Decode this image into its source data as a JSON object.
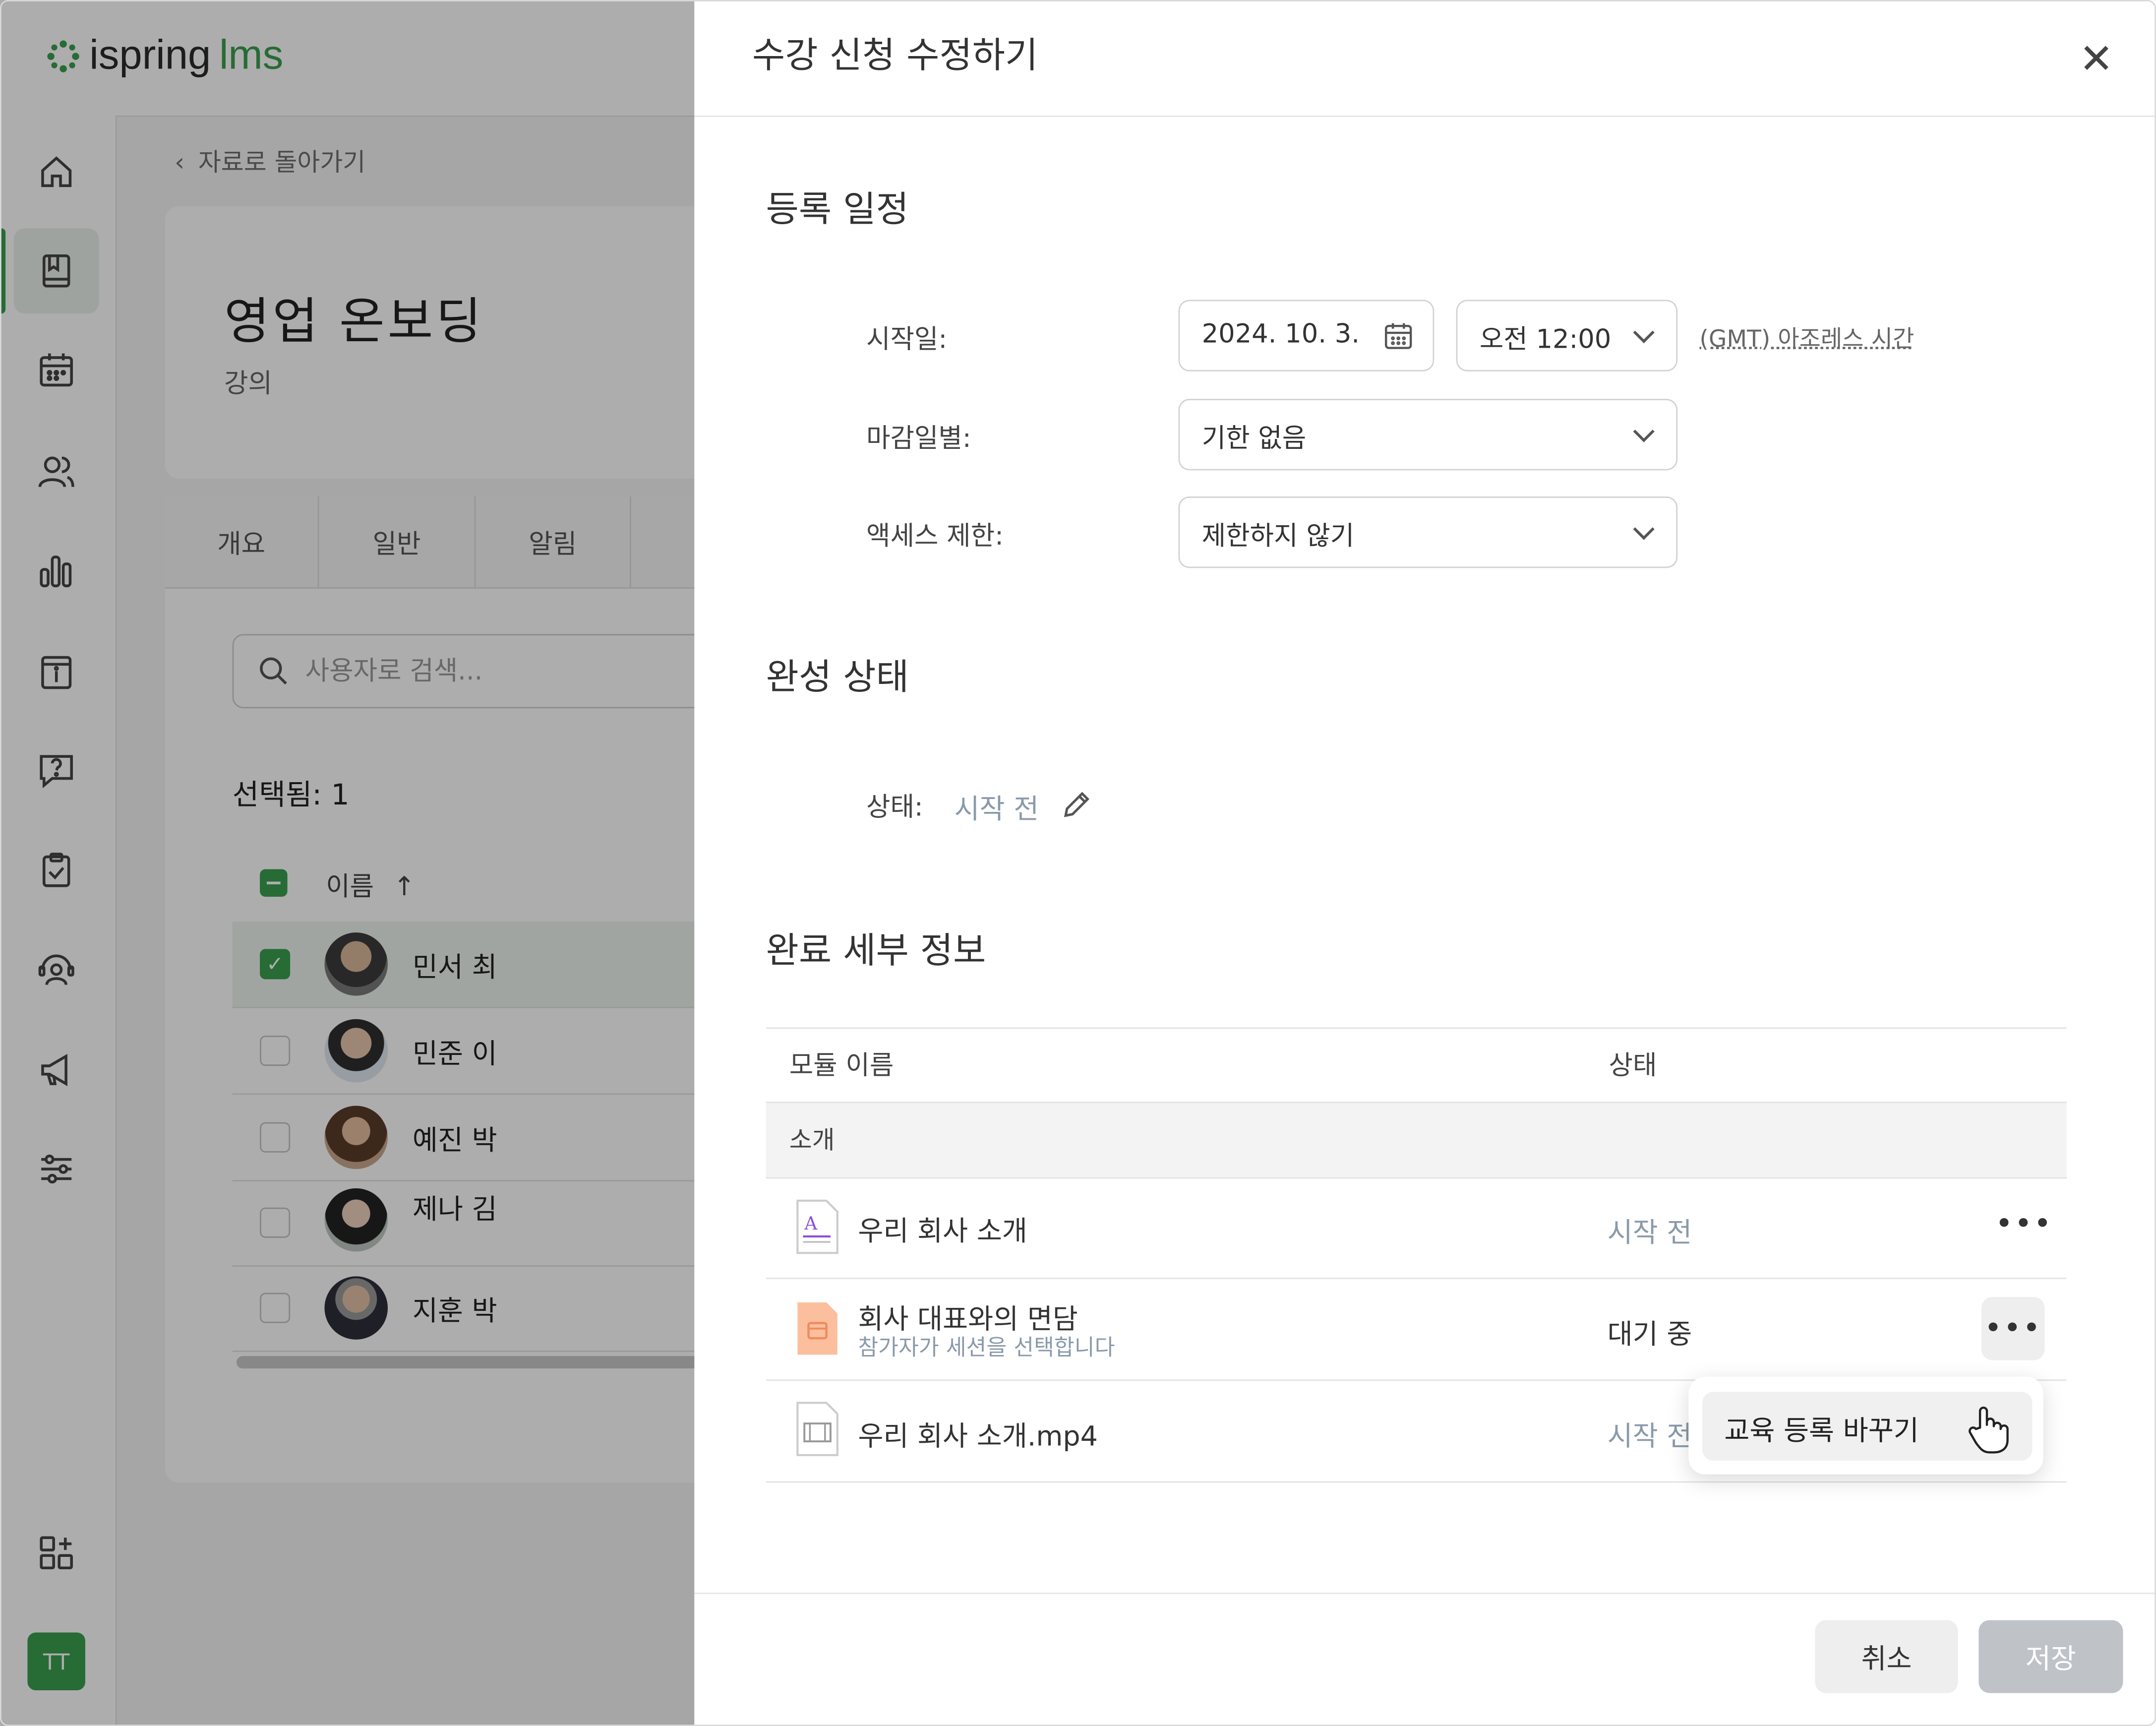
{
  "app": {
    "logo_main": "ispring",
    "logo_suffix": "lms",
    "back_link": "자료로 돌아가기",
    "course_title": "영업 온보딩",
    "course_type": "강의",
    "tabs": [
      "개요",
      "일반",
      "알림"
    ],
    "search_placeholder": "사용자로 검색...",
    "selected_count": "선택됨: 1",
    "name_header": "이름",
    "user_avatar": "TT",
    "users": [
      {
        "name": "민서 최",
        "checked": true
      },
      {
        "name": "민준 이",
        "checked": false
      },
      {
        "name": "예진 박",
        "checked": false
      },
      {
        "name": "제나 김",
        "checked": false
      },
      {
        "name": "지훈 박",
        "checked": false
      }
    ]
  },
  "dialog": {
    "title": "수강 신청 수정하기",
    "section_schedule": "등록 일정",
    "start_label": "시작일:",
    "start_date": "2024. 10. 3.",
    "start_time": "오전 12:00",
    "timezone": "(GMT) 아조레스 시간",
    "due_label": "마감일별:",
    "due_value": "기한 없음",
    "access_label": "액세스 제한:",
    "access_value": "제한하지 않기",
    "section_status": "완성 상태",
    "status_label": "상태:",
    "status_value": "시작 전",
    "section_details": "완료 세부 정보",
    "col_module": "모듈 이름",
    "col_status": "상태",
    "group": "소개",
    "modules": [
      {
        "name": "우리 회사 소개",
        "sub": "",
        "status": "시작 전",
        "icon": "document-icon"
      },
      {
        "name": "회사 대표와의 면담",
        "sub": "참가자가 세션을 선택합니다",
        "status": "대기 중",
        "icon": "calendar-icon"
      },
      {
        "name": "우리 회사 소개.mp4",
        "sub": "",
        "status": "시작 전",
        "icon": "video-icon"
      }
    ],
    "menu_item": "교육 등록 바꾸기",
    "cancel": "취소",
    "save": "저장"
  },
  "colors": {
    "brand": "#3a9e4f",
    "muted_status": "#8a9aab",
    "save_disabled": "#bfc3c8"
  }
}
